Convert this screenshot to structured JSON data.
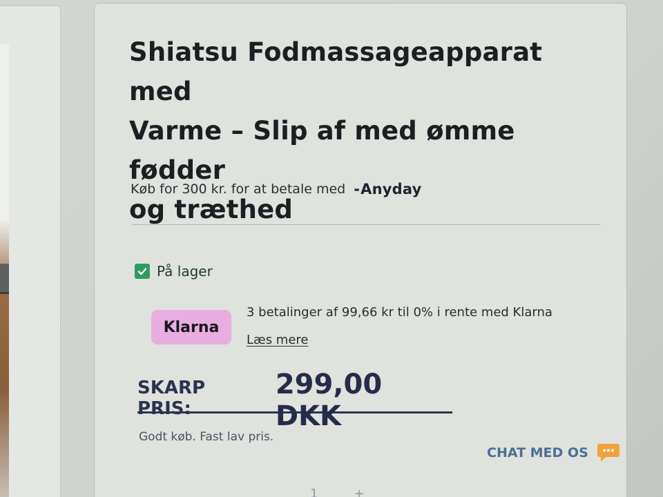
{
  "product": {
    "title_lines": [
      "Shiatsu Fodmassageapparat med",
      "Varme – Slip af med ømme fødder",
      "og træthed"
    ]
  },
  "anyday": {
    "text": "Køb for 300 kr. for at betale med",
    "logo_text": "Anyday"
  },
  "stock": {
    "icon": "check-icon",
    "label": "På lager"
  },
  "klarna": {
    "badge": "Klarna",
    "text": "3 betalinger af 99,66 kr til 0% i rente med Klarna",
    "link_label": "Læs mere"
  },
  "price": {
    "label": "SKARP PRIS:",
    "value": "299,00 DKK",
    "note": "Godt køb. Fast lav pris."
  },
  "chat": {
    "label": "CHAT MED OS",
    "icon": "chat-bubble-icon"
  },
  "quantity": {
    "value": "1",
    "increment": "+"
  },
  "colors": {
    "stock_green": "#2f9a63",
    "klarna_pink": "#e8aee0",
    "price_navy": "#262c48",
    "chat_blue": "#4b6f96",
    "chat_icon_orange": "#f0a23a"
  }
}
